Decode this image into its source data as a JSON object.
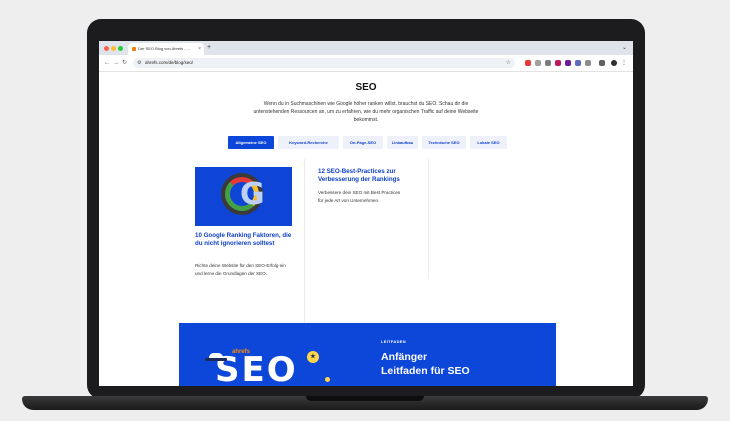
{
  "browser": {
    "tab_title": "Der SEO Blog von Ahrefs - ...",
    "tab_close": "×",
    "new_tab": "+",
    "url": "ahrefs.com/de/blog/seo/"
  },
  "page": {
    "title": "SEO",
    "intro": "Wenn du in Suchmaschinen wie Google höher ranken willst, brauchst du SEO. Schau dir die untenstehenden Ressourcen an, um zu erfahren, wie du mehr organischen Traffic auf deine Webseite bekommst."
  },
  "categories": [
    {
      "label": "Allgemeine SEO",
      "active": true
    },
    {
      "label": "Keyword-Recherche",
      "active": false
    },
    {
      "label": "On-Page-SEO",
      "active": false
    },
    {
      "label": "Linkaufbau",
      "active": false
    },
    {
      "label": "Technische SEO",
      "active": false
    },
    {
      "label": "Lokale SEO",
      "active": false
    }
  ],
  "posts": [
    {
      "title": "10 Google Ranking Faktoren, die du nicht ignorieren solltest",
      "excerpt": "Richte deine Website für den SEO-Erfolg ein und lerne die Grundlagen der SEO."
    },
    {
      "title": "12 SEO-Best-Practices zur Verbesserung der Rankings",
      "excerpt": "Verbessere dein SEO mit Best Practices für jede Art von Unternehmen."
    }
  ],
  "banner": {
    "brand": "ahrefs",
    "art_text": "SEO",
    "label": "LEITFADEN",
    "title_line1": "Anfänger",
    "title_line2": "Leitfaden für SEO"
  },
  "colors": {
    "accent": "#0d47d9",
    "link": "#0d3fc9",
    "brand_orange": "#ff8a00"
  }
}
